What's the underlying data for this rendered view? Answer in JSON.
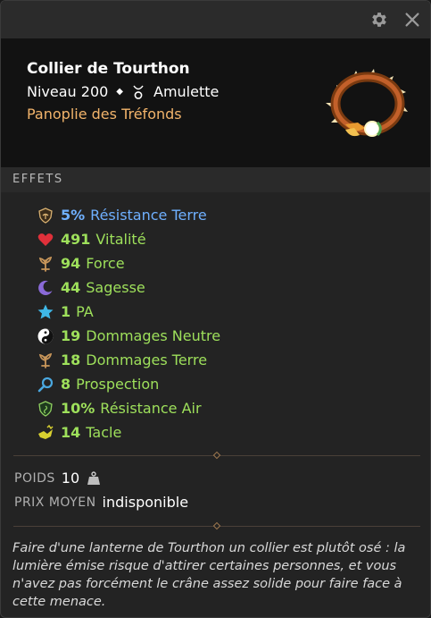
{
  "item": {
    "name": "Collier de Tourthon",
    "level": "Niveau 200",
    "type": "Amulette",
    "set": "Panoplie des Tréfonds"
  },
  "sections": {
    "effects": "EFFETS"
  },
  "effects": [
    {
      "icon": "earth-resistance-shield-icon",
      "value": "5%",
      "label": "Résistance Terre",
      "color": "#6fb0ff"
    },
    {
      "icon": "heart-icon",
      "value": "491",
      "label": "Vitalité",
      "color": "#9ee05b"
    },
    {
      "icon": "strength-sprout-icon",
      "value": "94",
      "label": "Force",
      "color": "#9ee05b"
    },
    {
      "icon": "wisdom-moon-icon",
      "value": "44",
      "label": "Sagesse",
      "color": "#9ee05b"
    },
    {
      "icon": "ap-star-icon",
      "value": "1",
      "label": "PA",
      "color": "#9ee05b"
    },
    {
      "icon": "neutral-yin-yang-icon",
      "value": "19",
      "label": "Dommages Neutre",
      "color": "#9ee05b"
    },
    {
      "icon": "earth-sprout-icon",
      "value": "18",
      "label": "Dommages Terre",
      "color": "#9ee05b"
    },
    {
      "icon": "prospecting-magnifier-icon",
      "value": "8",
      "label": "Prospection",
      "color": "#9ee05b"
    },
    {
      "icon": "air-resistance-shield-icon",
      "value": "10%",
      "label": "Résistance Air",
      "color": "#9ee05b"
    },
    {
      "icon": "lock-tackle-icon",
      "value": "14",
      "label": "Tacle",
      "color": "#9ee05b"
    }
  ],
  "info": {
    "weight_label": "POIDS",
    "weight_value": "10",
    "price_label": "PRIX MOYEN",
    "price_value": "indisponible"
  },
  "description": "Faire d'une lanterne de Tourthon un collier est plutôt osé : la lumière émise risque d'attirer certaines personnes, et vous n'avez pas forcément le crâne assez solide pour faire face à cette menace."
}
